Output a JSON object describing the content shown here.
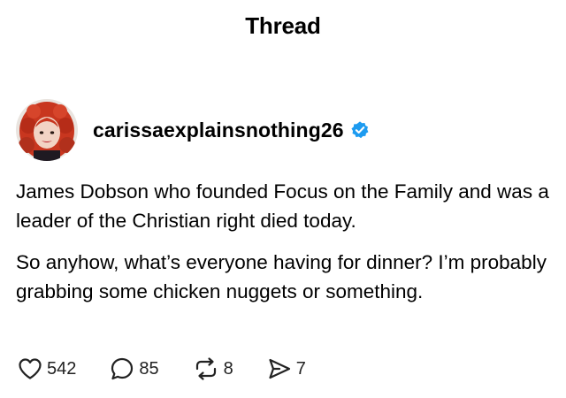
{
  "header": {
    "title": "Thread"
  },
  "post": {
    "username": "carissaexplainsnothing26",
    "verified": true,
    "paragraphs": [
      "James Dobson who founded Focus on the Family and was a leader of the Christian right died today.",
      "So anyhow, what’s everyone having for dinner? I’m probably grabbing some chicken nuggets or something."
    ],
    "actions": {
      "likes": "542",
      "replies": "85",
      "reposts": "8",
      "shares": "7"
    }
  },
  "icons": {
    "like": "heart-icon",
    "reply": "comment-bubble-icon",
    "repost": "repost-icon",
    "share": "send-icon",
    "verified": "verified-badge-icon"
  },
  "colors": {
    "verified": "#1d9bf0",
    "text": "#000000",
    "hair": "#c8361f"
  }
}
